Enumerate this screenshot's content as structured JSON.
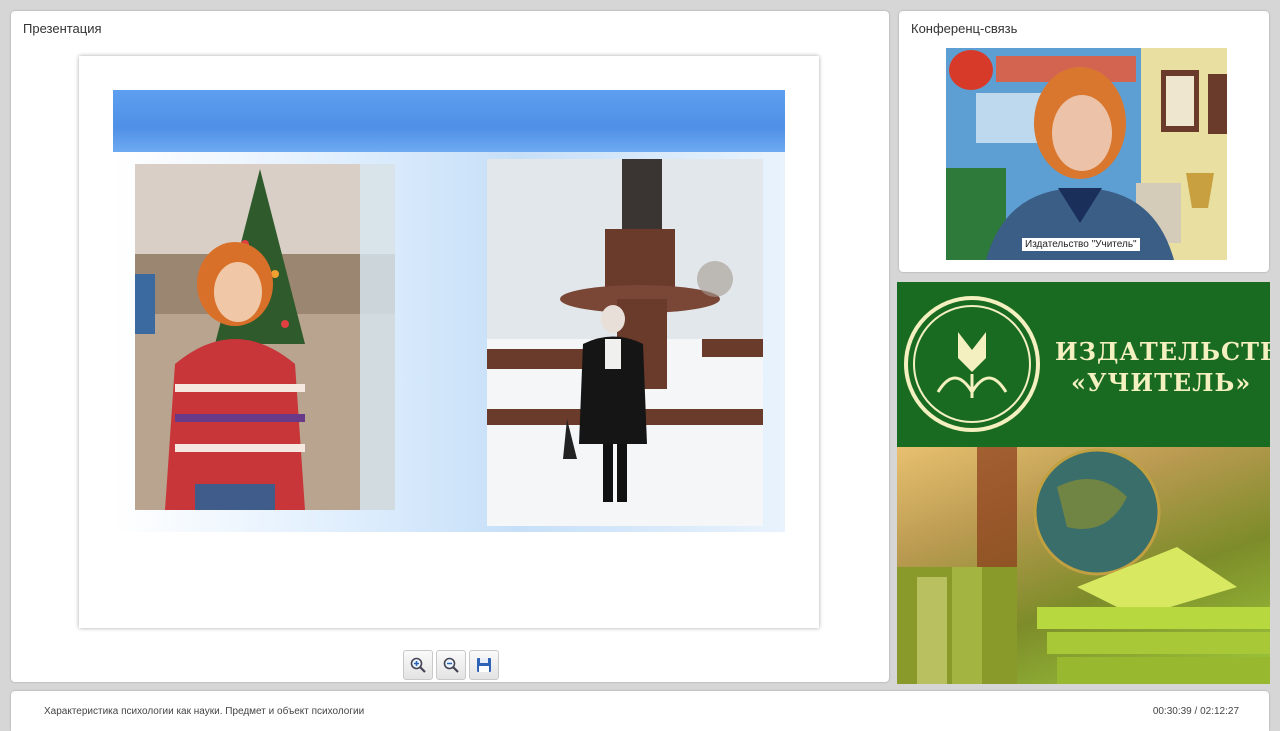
{
  "presentation": {
    "title": "Презентация",
    "toolbar": {
      "zoom_in_icon": "zoom-in-icon",
      "zoom_out_icon": "zoom-out-icon",
      "save_icon": "save-icon"
    }
  },
  "conference": {
    "title": "Конференц-связь",
    "caption": "Издательство \"Учитель\""
  },
  "brand": {
    "line1": "ИЗДАТЕЛЬСТВО",
    "line2": "«УЧИТЕЛЬ»"
  },
  "footer": {
    "lecture_title": "Характеристика психологии как науки. Предмет и объект психологии",
    "time": "00:30:39 / 02:12:27"
  },
  "colors": {
    "brand_green": "#1a6b22",
    "slide_header_blue": "#5e9ff0"
  }
}
